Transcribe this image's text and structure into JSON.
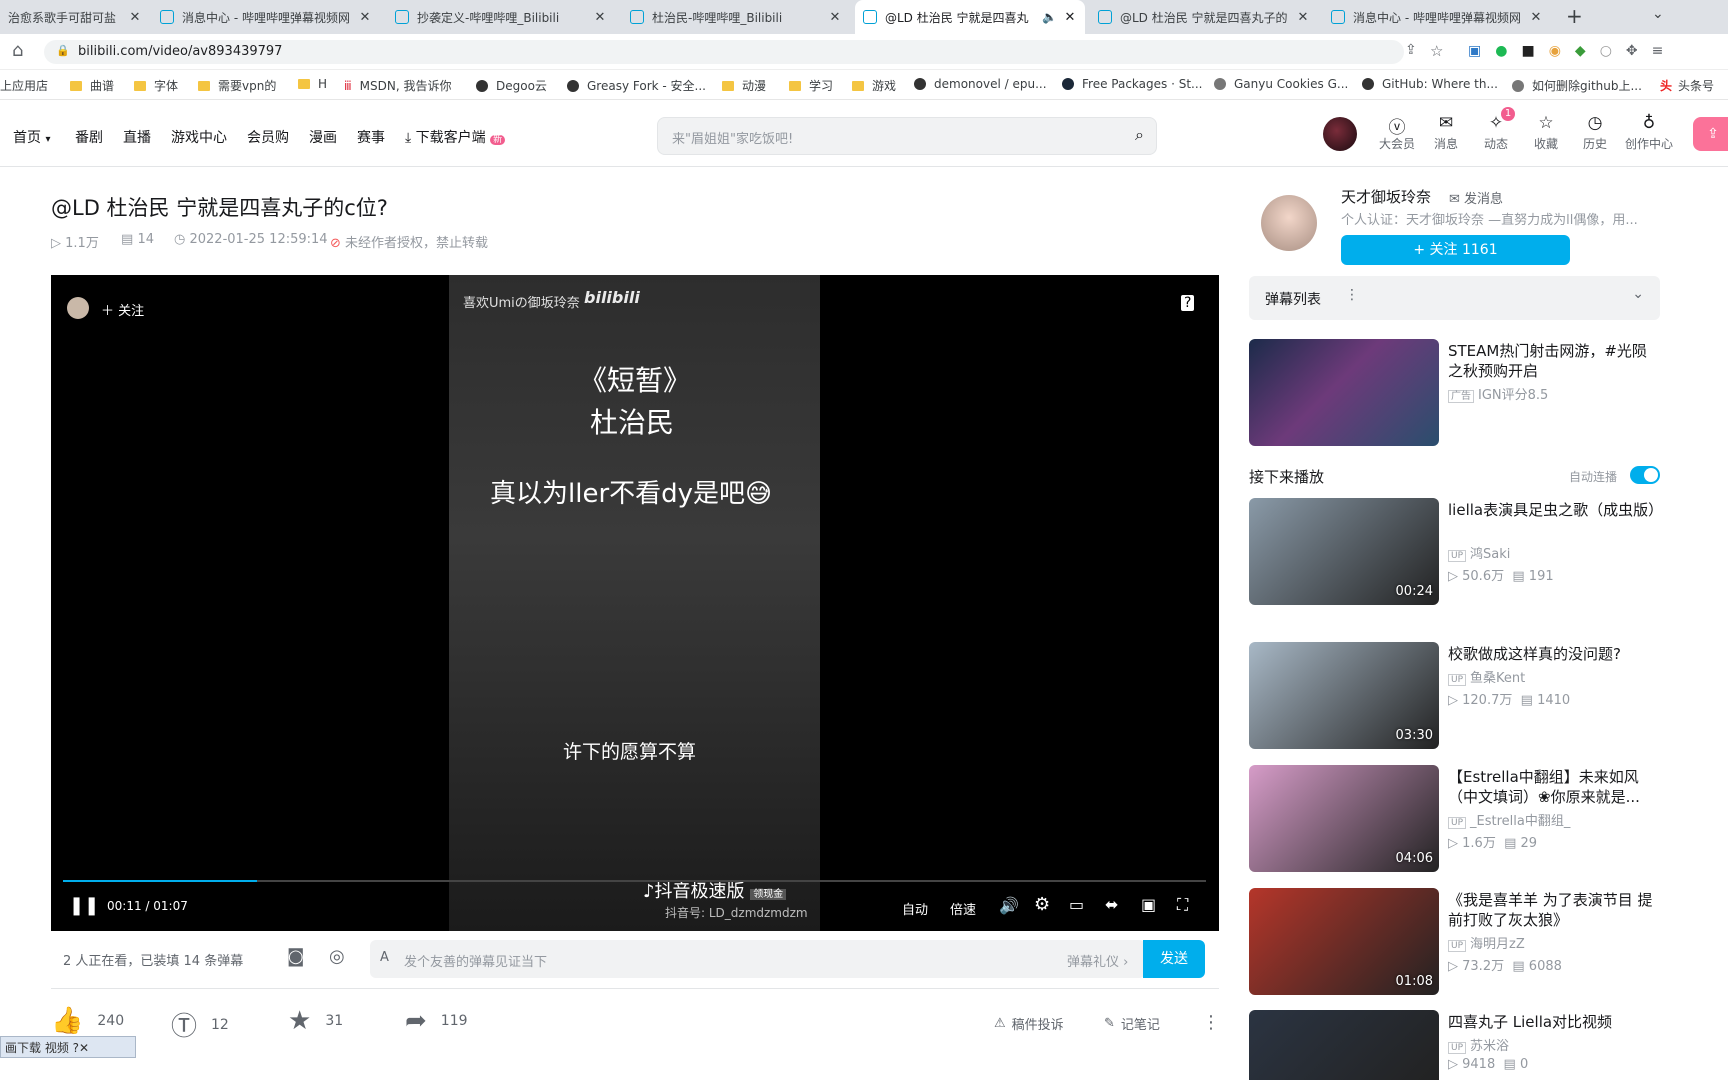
{
  "browser": {
    "tabs": [
      {
        "title": "治愈系歌手可甜可盐",
        "active": false
      },
      {
        "title": "消息中心 - 哔哩哔哩弹幕视频网",
        "active": false
      },
      {
        "title": "抄袭定义-哔哩哔哩_Bilibili",
        "active": false
      },
      {
        "title": "杜治民-哔哩哔哩_Bilibili",
        "active": false
      },
      {
        "title": "@LD 杜治民 宁就是四喜丸",
        "active": true
      },
      {
        "title": "@LD 杜治民 宁就是四喜丸子的",
        "active": false
      },
      {
        "title": "消息中心 - 哔哩哔哩弹幕视频网",
        "active": false
      }
    ],
    "new_tab": "+",
    "url": "bilibili.com/video/av893439797",
    "bookmarks": [
      {
        "label": "上应用店",
        "icon": "none"
      },
      {
        "label": "曲谱",
        "icon": "folder"
      },
      {
        "label": "字体",
        "icon": "folder"
      },
      {
        "label": "需要vpn的",
        "icon": "folder"
      },
      {
        "label": "H",
        "icon": "folder"
      },
      {
        "label": "MSDN, 我告诉你",
        "icon": "msdn"
      },
      {
        "label": "Degoo云",
        "icon": "degoo"
      },
      {
        "label": "Greasy Fork - 安全...",
        "icon": "greasyfork"
      },
      {
        "label": "动漫",
        "icon": "folder"
      },
      {
        "label": "学习",
        "icon": "folder"
      },
      {
        "label": "游戏",
        "icon": "folder"
      },
      {
        "label": "demonovel / epu...",
        "icon": "github"
      },
      {
        "label": "Free Packages · St...",
        "icon": "steam"
      },
      {
        "label": "Ganyu Cookies G...",
        "icon": "globe"
      },
      {
        "label": "GitHub: Where th...",
        "icon": "github"
      },
      {
        "label": "如何删除github上...",
        "icon": "globe"
      },
      {
        "label": "头条号",
        "icon": "toutiao"
      }
    ]
  },
  "header": {
    "nav": [
      "首页",
      "番剧",
      "直播",
      "游戏中心",
      "会员购",
      "漫画",
      "赛事",
      "下载客户端"
    ],
    "download_badge": "新",
    "search_placeholder": "来\"眉姐姐\"家吃饭吧!",
    "icons": [
      {
        "label": "大会员",
        "icon": "vip-icon"
      },
      {
        "label": "消息",
        "icon": "message-icon"
      },
      {
        "label": "动态",
        "icon": "dynamic-icon",
        "badge": "1"
      },
      {
        "label": "收藏",
        "icon": "star-icon"
      },
      {
        "label": "历史",
        "icon": "clock-icon"
      },
      {
        "label": "创作中心",
        "icon": "bulb-icon"
      }
    ]
  },
  "video": {
    "title": "@LD 杜治民 宁就是四喜丸子的c位?",
    "views": "1.1万",
    "danmaku_count": "14",
    "date": "2022-01-25 12:59:14",
    "copyright": "未经作者授权，禁止转载",
    "player": {
      "follow_label": "关注",
      "watermark": "喜欢Umiの御坂玲奈",
      "bili_logo": "bilibili",
      "overlay_title": "《短暂》",
      "overlay_artist": "杜治民",
      "overlay_comment": "真以为ller不看dy是吧😅",
      "subtitle": "许下的愿算不算",
      "douyin_logo": "抖音极速版",
      "douyin_tag": "领现金",
      "douyin_id": "抖音号: LD_dzmdzmdzm",
      "time_current": "00:11",
      "time_total": "01:07",
      "progress": 0.17,
      "controls": [
        "自动",
        "倍速"
      ]
    },
    "danmaku_bar": {
      "viewers": "2 人正在看，已装填 14 条弹幕",
      "placeholder": "发个友善的弹幕见证当下",
      "etiquette": "弹幕礼仪",
      "send": "发送"
    },
    "actions": {
      "like": "240",
      "coin": "12",
      "favorite": "31",
      "share": "119",
      "report": "稿件投诉",
      "notes": "记笔记"
    },
    "floating_tool": "画下载 视频"
  },
  "sidebar": {
    "uploader": {
      "name": "天才御坂玲奈",
      "message": "发消息",
      "desc": "个人认证：天才御坂玲奈 —直努力成为ll偶像，用...",
      "follow": "+ 关注 1161"
    },
    "danmaku_list": "弹幕列表",
    "ad": {
      "title": "STEAM热门射击网游，#光陨之秋预购开启",
      "tag": "广告",
      "source": "IGN评分8.5"
    },
    "up_next": "接下来播放",
    "autoplay": "自动连播",
    "recommendations": [
      {
        "title": "liella表演具足虫之歌（成虫版）",
        "up": "鸿Saki",
        "views": "50.6万",
        "danmaku": "191",
        "duration": "00:24",
        "color": "#8a9aa8"
      },
      {
        "title": "校歌做成这样真的没问题?",
        "up": "鱼桑Kent",
        "views": "120.7万",
        "danmaku": "1410",
        "duration": "03:30",
        "color": "#a8b8c6"
      },
      {
        "title": "【Estrella中翻组】未来如风（中文填词）❀你原来就是...",
        "up": "_Estrella中翻组_",
        "views": "1.6万",
        "danmaku": "29",
        "duration": "04:06",
        "color": "#d69cc8"
      },
      {
        "title": "《我是喜羊羊 为了表演节目 提前打败了灰太狼》",
        "up": "海明月zZ",
        "views": "73.2万",
        "danmaku": "6088",
        "duration": "01:08",
        "color": "#b5362a"
      },
      {
        "title": "四喜丸子 Liella对比视频",
        "up": "苏米浴",
        "views": "9418",
        "danmaku": "0",
        "duration": "",
        "color": "#2b3442"
      }
    ]
  }
}
